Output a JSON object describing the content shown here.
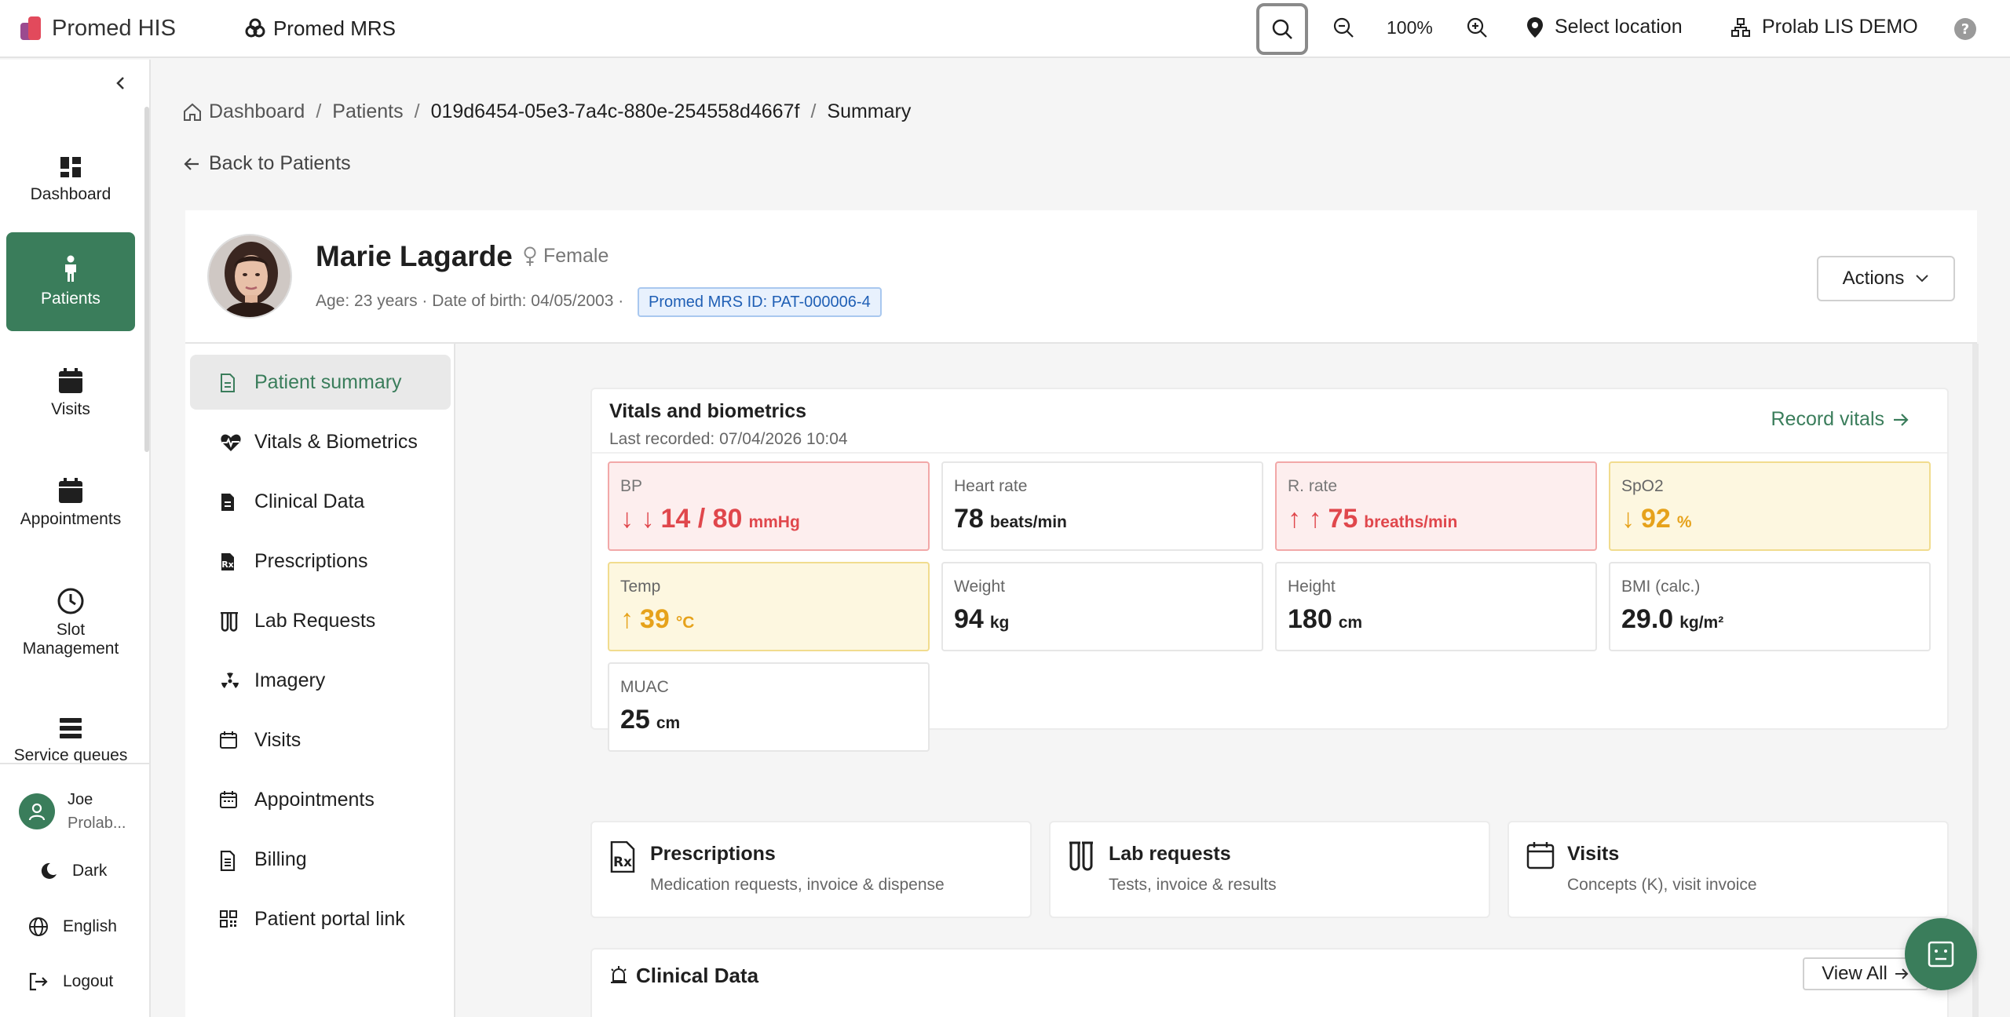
{
  "topbar": {
    "brand": "Promed HIS",
    "module": "Promed MRS",
    "zoom": "100%",
    "location": "Select location",
    "lis": "Prolab LIS DEMO"
  },
  "nav": {
    "items": [
      {
        "label": "Dashboard",
        "icon": "dashboard-icon"
      },
      {
        "label": "Patients",
        "icon": "person-icon"
      },
      {
        "label": "Visits",
        "icon": "calendar-icon"
      },
      {
        "label": "Appointments",
        "icon": "calendar-icon"
      },
      {
        "label": "Slot Management",
        "icon": "clock-icon"
      },
      {
        "label": "Service queues",
        "icon": "queue-icon"
      }
    ],
    "user_name": "Joe",
    "user_org": "Prolab...",
    "theme": "Dark",
    "language": "English",
    "logout": "Logout"
  },
  "breadcrumb": {
    "home": "Dashboard",
    "patients": "Patients",
    "id": "019d6454-05e3-7a4c-880e-254558d4667f",
    "current": "Summary"
  },
  "back_label": "Back to Patients",
  "patient": {
    "name": "Marie Lagarde",
    "gender": "Female",
    "meta": "Age: 23 years · Date of birth: 04/05/2003 ·",
    "mrs_id": "Promed MRS ID: PAT-000006-4",
    "actions": "Actions"
  },
  "subnav": [
    "Patient summary",
    "Vitals & Biometrics",
    "Clinical Data",
    "Prescriptions",
    "Lab Requests",
    "Imagery",
    "Visits",
    "Appointments",
    "Billing",
    "Patient portal link"
  ],
  "vitals": {
    "title": "Vitals and biometrics",
    "last_recorded": "Last recorded: 07/04/2026 10:04",
    "record": "Record vitals",
    "tiles": [
      {
        "label": "BP",
        "arrow": "↓ ↓",
        "value": "14 / 80",
        "unit": "mmHg",
        "status": "low"
      },
      {
        "label": "Heart rate",
        "arrow": "",
        "value": "78",
        "unit": "beats/min",
        "status": "normal"
      },
      {
        "label": "R. rate",
        "arrow": "↑ ↑",
        "value": "75",
        "unit": "breaths/min",
        "status": "high"
      },
      {
        "label": "SpO2",
        "arrow": "↓",
        "value": "92",
        "unit": "%",
        "status": "warn"
      },
      {
        "label": "Temp",
        "arrow": "↑",
        "value": "39",
        "unit": "°C",
        "status": "warn"
      },
      {
        "label": "Weight",
        "arrow": "",
        "value": "94",
        "unit": "kg",
        "status": "normal"
      },
      {
        "label": "Height",
        "arrow": "",
        "value": "180",
        "unit": "cm",
        "status": "normal"
      },
      {
        "label": "BMI (calc.)",
        "arrow": "",
        "value": "29.0",
        "unit": "kg/m²",
        "status": "normal"
      },
      {
        "label": "MUAC",
        "arrow": "",
        "value": "25",
        "unit": "cm",
        "status": "normal"
      }
    ]
  },
  "quick": [
    {
      "title": "Prescriptions",
      "sub": "Medication requests, invoice & dispense"
    },
    {
      "title": "Lab requests",
      "sub": "Tests, invoice & results"
    },
    {
      "title": "Visits",
      "sub": "Concepts (K), visit invoice"
    }
  ],
  "clinical": {
    "title": "Clinical Data",
    "view_all": "View All"
  },
  "colors": {
    "accent": "#3a7d5b",
    "danger": "#e0474c",
    "warning": "#e6a21b",
    "id_badge": "#1f5fb5"
  }
}
